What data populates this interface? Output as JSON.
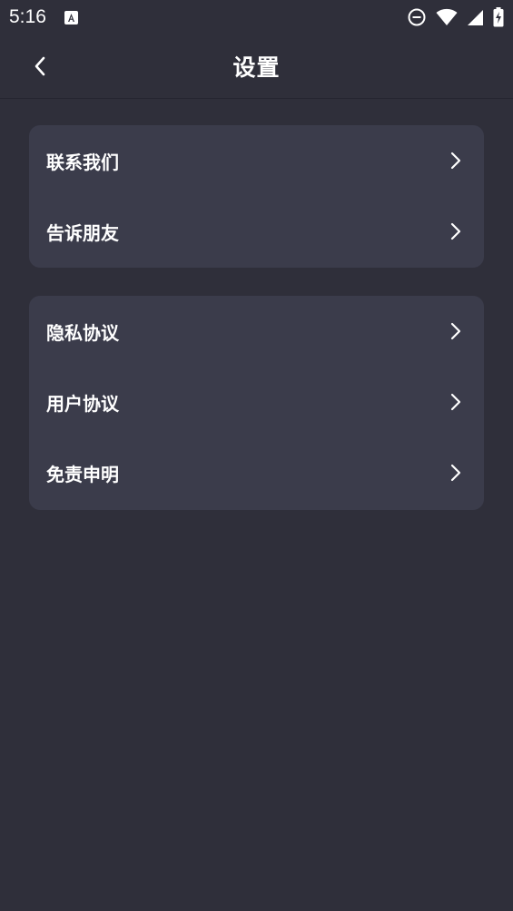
{
  "status_bar": {
    "time": "5:16",
    "icons": [
      "font-a-icon",
      "do-not-disturb-icon",
      "wifi-icon",
      "signal-icon",
      "battery-charging-icon"
    ]
  },
  "header": {
    "title": "设置",
    "back_icon": "chevron-left-icon"
  },
  "groups": [
    {
      "items": [
        {
          "label": "联系我们",
          "icon": "chevron-right-icon"
        },
        {
          "label": "告诉朋友",
          "icon": "chevron-right-icon"
        }
      ]
    },
    {
      "items": [
        {
          "label": "隐私协议",
          "icon": "chevron-right-icon"
        },
        {
          "label": "用户协议",
          "icon": "chevron-right-icon"
        },
        {
          "label": "免责申明",
          "icon": "chevron-right-icon"
        }
      ]
    }
  ],
  "colors": {
    "background": "#2f2f3a",
    "card": "#3b3c4b",
    "text": "#ffffff"
  }
}
